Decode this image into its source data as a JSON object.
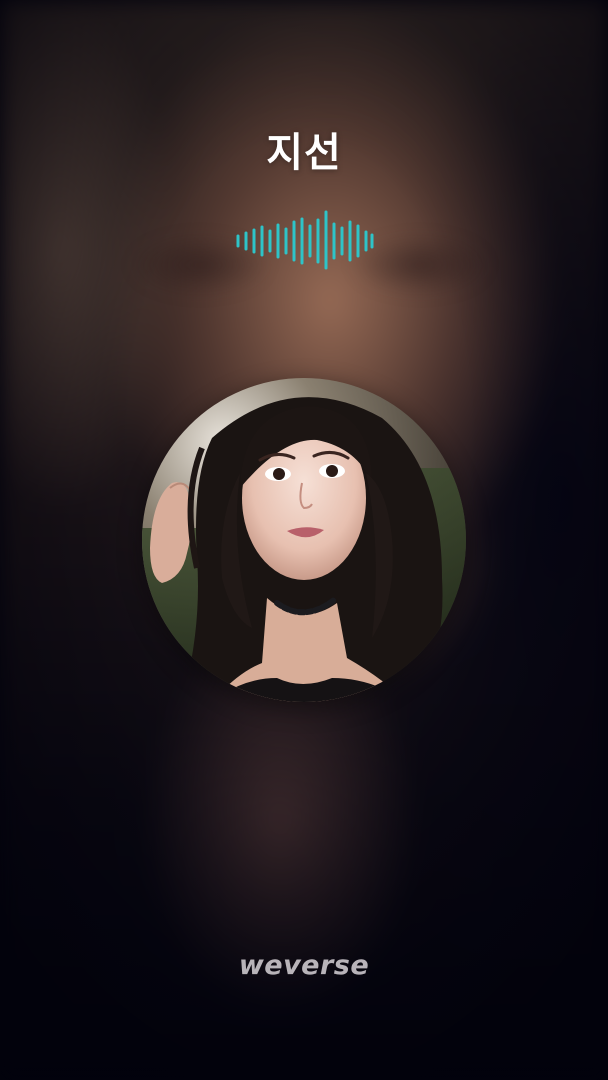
{
  "live": {
    "artist_name": "지선"
  },
  "brand": {
    "logo_text": "weverse"
  },
  "colors": {
    "waveform": "#2ec4c8",
    "name_text": "#ffffff",
    "background": "#050510"
  },
  "icons": {
    "audio_waveform": "audio-waveform-icon"
  }
}
